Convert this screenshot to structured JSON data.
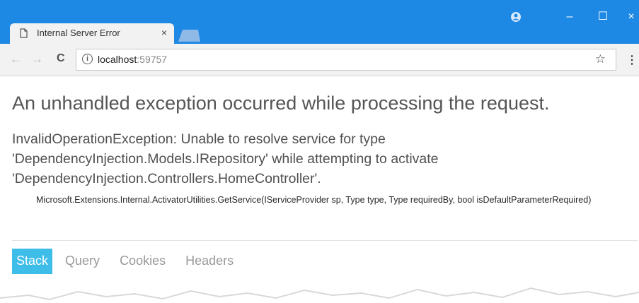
{
  "browser": {
    "tab_title": "Internal Server Error",
    "tab_close": "×",
    "url_host": "localhost",
    "url_port": ":59757",
    "window_controls": {
      "account": "account-icon",
      "minimize": "–",
      "maximize": "☐",
      "close": "×"
    }
  },
  "page": {
    "heading": "An unhandled exception occurred while processing the request.",
    "error_message": "InvalidOperationException: Unable to resolve service for type 'DependencyInjection.Models.IRepository' while attempting to activate 'DependencyInjection.Controllers.HomeController'.",
    "error_location": "Microsoft.Extensions.Internal.ActivatorUtilities.GetService(IServiceProvider sp, Type type, Type requiredBy, bool isDefaultParameterRequired)",
    "tabs": [
      {
        "label": "Stack"
      },
      {
        "label": "Query"
      },
      {
        "label": "Cookies"
      },
      {
        "label": "Headers"
      }
    ]
  },
  "colors": {
    "titlebar": "#1e88e5",
    "active_tab": "#3dbde8"
  }
}
